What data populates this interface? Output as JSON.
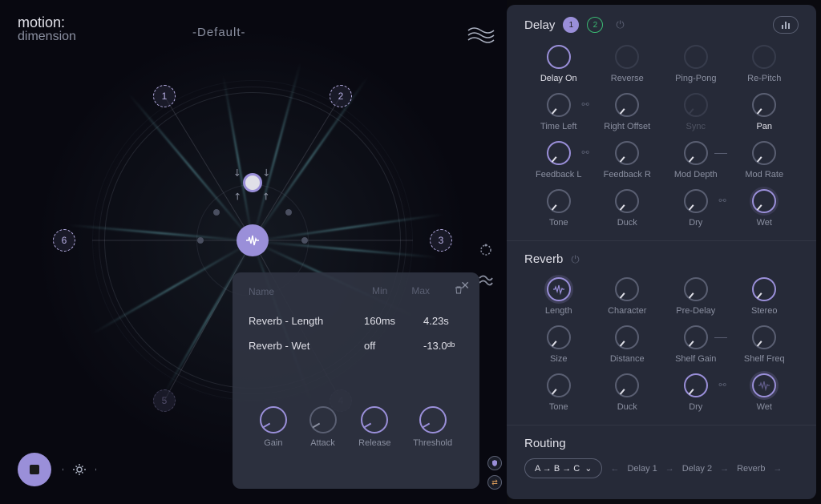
{
  "app": {
    "logo_top": "motion:",
    "logo_bottom": "dimension",
    "preset": "-Default-"
  },
  "orbit": {
    "nodes": {
      "n1": "1",
      "n2": "2",
      "n3": "3",
      "n4": "4",
      "n5": "5",
      "n6": "6"
    }
  },
  "popup": {
    "col_name": "Name",
    "col_min": "Min",
    "col_max": "Max",
    "rows": [
      {
        "name": "Reverb - Length",
        "min": "160ms",
        "max": "4.23s"
      },
      {
        "name": "Reverb - Wet",
        "min": "off",
        "max": "-13.0ᵈᵇ"
      }
    ],
    "knobs": {
      "gain": "Gain",
      "attack": "Attack",
      "release": "Release",
      "threshold": "Threshold"
    }
  },
  "delay": {
    "title": "Delay",
    "tab1": "1",
    "tab2": "2",
    "knobs": {
      "delay_on": "Delay On",
      "reverse": "Reverse",
      "pingpong": "Ping-Pong",
      "repitch": "Re-Pitch",
      "time_left": "Time Left",
      "right_offset": "Right Offset",
      "sync": "Sync",
      "pan": "Pan",
      "feedback_l": "Feedback L",
      "feedback_r": "Feedback R",
      "mod_depth": "Mod Depth",
      "mod_rate": "Mod Rate",
      "tone": "Tone",
      "duck": "Duck",
      "dry": "Dry",
      "wet": "Wet"
    }
  },
  "reverb": {
    "title": "Reverb",
    "knobs": {
      "length": "Length",
      "character": "Character",
      "predelay": "Pre-Delay",
      "stereo": "Stereo",
      "size": "Size",
      "distance": "Distance",
      "shelf_gain": "Shelf Gain",
      "shelf_freq": "Shelf Freq",
      "tone": "Tone",
      "duck": "Duck",
      "dry": "Dry",
      "wet": "Wet"
    }
  },
  "routing": {
    "title": "Routing",
    "select": "A → B → C",
    "chain": {
      "d1": "Delay 1",
      "d2": "Delay 2",
      "rv": "Reverb"
    }
  }
}
